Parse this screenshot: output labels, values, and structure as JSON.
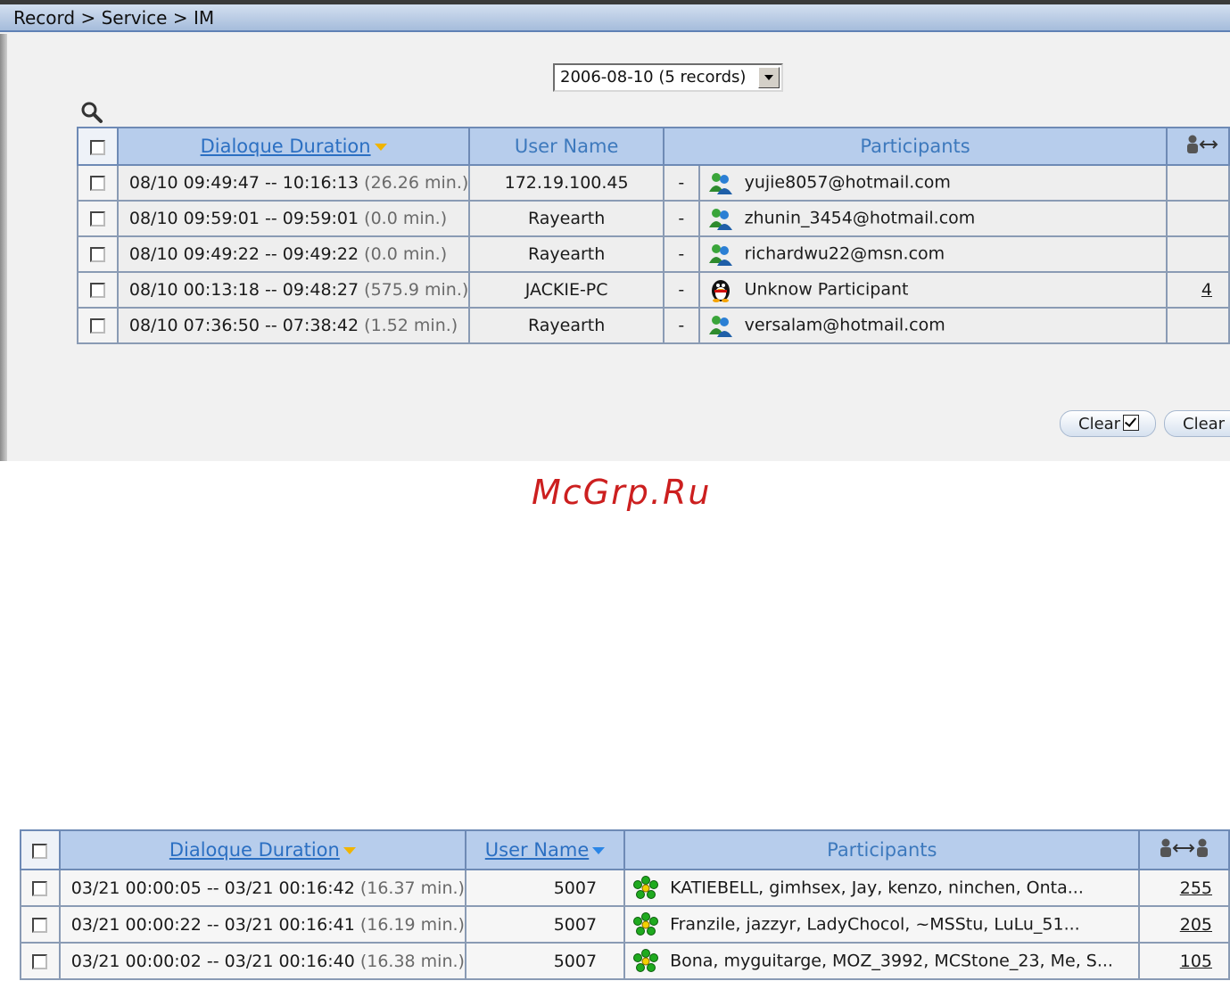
{
  "breadcrumb": "Record > Service > IM",
  "date_select": {
    "value": "2006-08-10 (5 records)"
  },
  "table1": {
    "headers": {
      "duration": "Dialoque Duration",
      "user": "User Name",
      "participants": "Participants",
      "count_icon": "user-exchange-icon"
    },
    "rows": [
      {
        "duration": "08/10 09:49:47 -- 10:16:13",
        "minutes": "(26.26 min.)",
        "user": "172.19.100.45",
        "dash": "-",
        "icon": "msn-icon",
        "participant": "yujie8057@hotmail.com",
        "count": ""
      },
      {
        "duration": "08/10 09:59:01 -- 09:59:01",
        "minutes": "(0.0 min.)",
        "user": "Rayearth",
        "dash": "-",
        "icon": "msn-icon",
        "participant": "zhunin_3454@hotmail.com",
        "count": ""
      },
      {
        "duration": "08/10 09:49:22 -- 09:49:22",
        "minutes": "(0.0 min.)",
        "user": "Rayearth",
        "dash": "-",
        "icon": "msn-icon",
        "participant": "richardwu22@msn.com",
        "count": ""
      },
      {
        "duration": "08/10 00:13:18 -- 09:48:27",
        "minutes": "(575.9 min.)",
        "user": "JACKIE-PC",
        "dash": "-",
        "icon": "qq-penguin-icon",
        "participant": "Unknow Participant",
        "count": "4"
      },
      {
        "duration": "08/10 07:36:50 -- 07:38:42",
        "minutes": "(1.52 min.)",
        "user": "Rayearth",
        "dash": "-",
        "icon": "msn-icon",
        "participant": "versalam@hotmail.com",
        "count": ""
      }
    ]
  },
  "buttons": {
    "clear_checked": "Clear",
    "clear_all": "Clear"
  },
  "watermark": "McGrp.Ru",
  "table2": {
    "headers": {
      "duration": "Dialoque Duration",
      "user": "User Name",
      "participants": "Participants",
      "count_icon": "user-exchange-icon"
    },
    "rows": [
      {
        "duration": "03/21 00:00:05 -- 03/21 00:16:42",
        "minutes": "(16.37 min.)",
        "user": "5007",
        "icon": "icq-flower-icon",
        "participant": "KATIEBELL, gimhsex, Jay, kenzo, ninchen, Onta...",
        "count": "255"
      },
      {
        "duration": "03/21 00:00:22 -- 03/21 00:16:41",
        "minutes": "(16.19 min.)",
        "user": "5007",
        "icon": "icq-flower-icon",
        "participant": "Franzile, jazzyr, LadyChocol, ~MSStu, LuLu_51...",
        "count": "205"
      },
      {
        "duration": "03/21 00:00:02 -- 03/21 00:16:40",
        "minutes": "(16.38 min.)",
        "user": "5007",
        "icon": "icq-flower-icon",
        "participant": "Bona, myguitarge, MOZ_3992, MCStone_23, Me, S...",
        "count": "105"
      }
    ]
  },
  "colors": {
    "header_bg": "#b7cdec",
    "header_text": "#3d79bd",
    "sort_indicator": "#f0b400",
    "watermark": "#cc1f1f"
  }
}
